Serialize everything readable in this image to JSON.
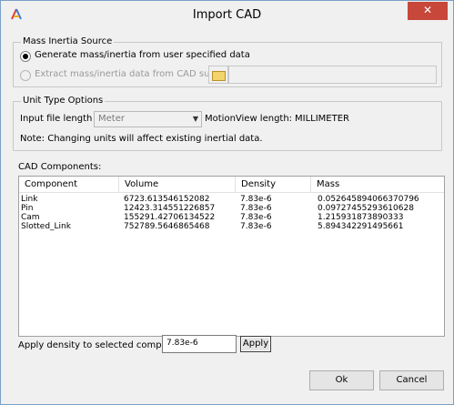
{
  "window": {
    "title": "Import CAD",
    "close_symbol": "✕"
  },
  "mass_inertia": {
    "legend": "Mass Inertia Source",
    "option1": "Generate mass/inertia from user specified data",
    "option2": "Extract mass/inertia data from CAD summary file:"
  },
  "unit_type": {
    "legend": "Unit Type Options",
    "input_length_label": "Input file length :",
    "input_length_value": "Meter",
    "motionview_label": "MotionView length:",
    "motionview_value": "MILLIMETER",
    "note": "Note: Changing units will affect existing inertial data."
  },
  "cad": {
    "label": "CAD Components:",
    "columns": [
      "Component",
      "Volume",
      "Density",
      "Mass"
    ],
    "rows": [
      [
        "Link",
        "6723.613546152082",
        "7.83e-6",
        "0.052645894066370796"
      ],
      [
        "Pin",
        "12423.314551226857",
        "7.83e-6",
        "0.09727455293610628"
      ],
      [
        "Cam",
        "155291.42706134522",
        "7.83e-6",
        "1.215931873890333"
      ],
      [
        "Slotted_Link",
        "752789.5646865468",
        "7.83e-6",
        "5.894342291495661"
      ]
    ]
  },
  "density": {
    "label": "Apply density to selected components:",
    "value": "7.83e-6",
    "apply_label": "Apply"
  },
  "buttons": {
    "ok": "Ok",
    "cancel": "Cancel"
  },
  "colors": {
    "close_red": "#c7473b",
    "border_blue": "#7a9fc6"
  }
}
